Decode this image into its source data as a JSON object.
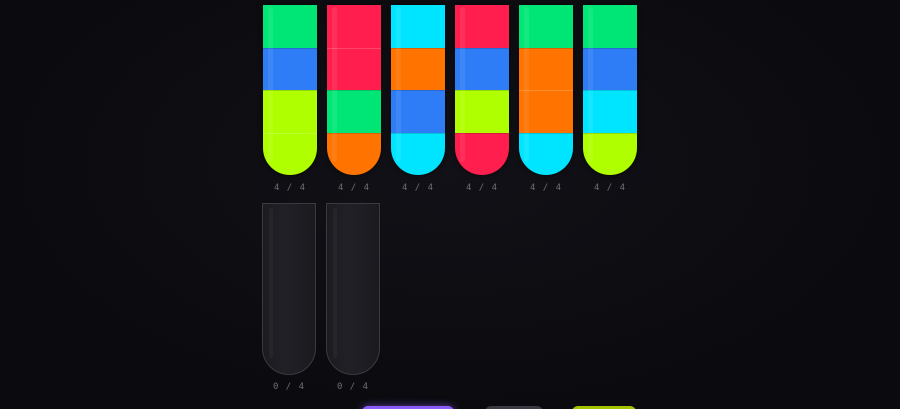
{
  "palette": {
    "green": "#00e676",
    "blue": "#2f7df6",
    "lime": "#b0ff00",
    "red": "#ff1e4e",
    "orange": "#ff7300",
    "cyan": "#00e5ff"
  },
  "capacity": 4,
  "tubes": [
    {
      "count": "4 / 4",
      "layers": [
        "green",
        "blue",
        "lime",
        "lime"
      ]
    },
    {
      "count": "4 / 4",
      "layers": [
        "red",
        "red",
        "green",
        "orange"
      ]
    },
    {
      "count": "4 / 4",
      "layers": [
        "cyan",
        "orange",
        "blue",
        "cyan"
      ]
    },
    {
      "count": "4 / 4",
      "layers": [
        "red",
        "blue",
        "lime",
        "red"
      ]
    },
    {
      "count": "4 / 4",
      "layers": [
        "green",
        "orange",
        "orange",
        "cyan"
      ]
    },
    {
      "count": "4 / 4",
      "layers": [
        "green",
        "blue",
        "cyan",
        "lime"
      ]
    },
    {
      "count": "0 / 4",
      "layers": []
    },
    {
      "count": "0 / 4",
      "layers": []
    }
  ]
}
